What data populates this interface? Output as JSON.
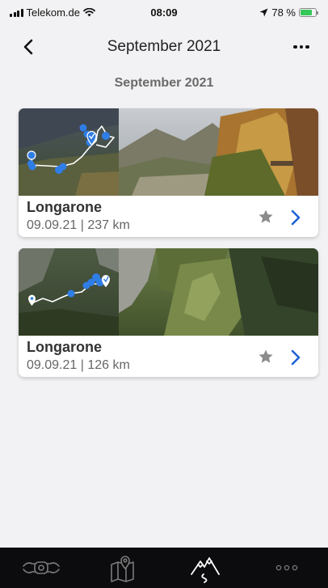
{
  "status_bar": {
    "carrier": "Telekom.de",
    "time": "08:09",
    "battery": "78 %",
    "battery_level": 0.78,
    "icons": [
      "signal-icon",
      "wifi-icon",
      "location-arrow-icon",
      "battery-charging-icon"
    ]
  },
  "nav": {
    "title": "September 2021",
    "back_icon": "chevron-left-icon",
    "more_icon": "more-dots-icon"
  },
  "section_title": "September 2021",
  "cards": [
    {
      "title": "Longarone",
      "meta": "09.09.21 | 237 km",
      "favorite": false
    },
    {
      "title": "Longarone",
      "meta": "09.09.21 | 126 km",
      "favorite": false
    }
  ],
  "tab_bar": {
    "tabs": [
      "motorcycle-icon",
      "map-pin-icon",
      "mountain-route-icon",
      "more-icon"
    ],
    "active": "mountain-route-icon"
  },
  "colors": {
    "accent": "#1e63d6",
    "route_blue": "#2f7de6",
    "background": "#f2f2f4",
    "tab_bar": "#0c0c0e"
  }
}
